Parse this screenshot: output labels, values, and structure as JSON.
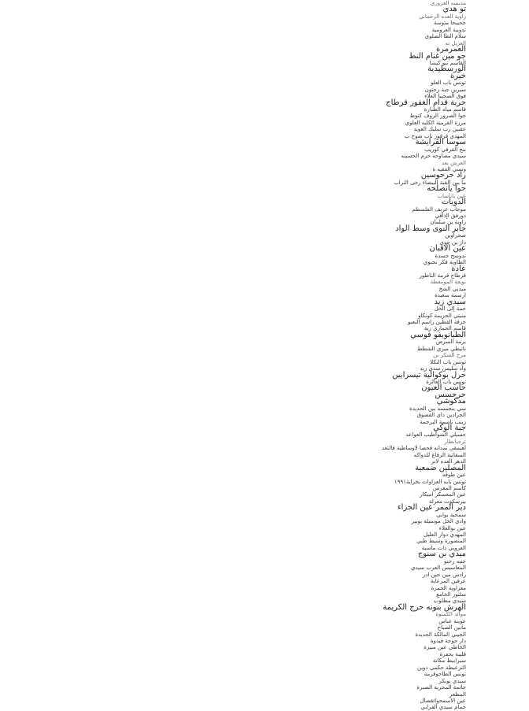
{
  "lines": [
    "مديسه الغزوري",
    "تو ھدي",
    "زاوية العده الرحماني",
    "جحيبحا متوسة",
    "تدويبة العرومية",
    "سلام الظا الصلوي",
    "العزيل نه",
    "العمرمرة",
    "جو مين غنام النط",
    "القاسم تبو كيسا",
    "الورسطيدية",
    "خيرة",
    "تونس باب العلو",
    "سيرين جبة رحتون",
    "فوق الصحيبا العلاء",
    "حربة قدام الغفور قرطاج",
    "قاسم مياه الطبارة",
    "جوا الصرور الروف كنوط",
    "مرزة القرمية الكليه العلوي",
    "عقبين رب سليك العويد",
    "المهدي قرقوز ناب شوخ ب",
    "سوسا القرايشة",
    "بنج القرفي كوريب",
    "سيدي مصاوحه حرم الحسينه",
    "العرش بعد",
    "ونسي الفقيه ة",
    "راد حرحوسين",
    "ما بين القبة البيضاء رحى التراب",
    "حوا يانصلحه",
    "عين باناساب",
    "الدويات",
    "موجاب عريف الفلسطم",
    "دورفق اإذاقي",
    "راوية بن سلمان",
    "جابر النوى وسط الواد",
    "صحراوين",
    "دار بن جوي",
    "عين الاقبان",
    "تدوسح جسدة",
    "الطاوية فكر نجبوي",
    "عادة",
    "قرطاج قرمة الناظور",
    "نويعة المومعطة",
    "ميديي الشخ",
    "ارسمة سعيدة",
    "سيدي زيد",
    "حمة إلى الخل",
    "منيتي الحزيمة كونكاو",
    "حرقة القطين راسم النعبو",
    "قاسم الحماري زية",
    "الطبانوبفو فوسي",
    "برمة السرص",
    "ناتيطي ميري الشطط",
    "مرح الشكر بن",
    "تونس باب النكلا",
    "واد سليمن سدي زيد",
    "حرل بوكوالية تيسرايين",
    "تونس باب العالرة",
    "حاسب العيون",
    "حرحسس",
    "مدكوشي",
    "سي بنجمسه بين الحديدة",
    "الجرادين داي القصوق",
    "زينب ناسمة البرجمة",
    "جبة الوكي",
    "حسيلي الشواطيب العواعد",
    "ترجبانطار",
    "اهيمقى تمدانه فحصا لاوساطية فالتعد",
    "السقاتية الرفاع للدواكه",
    "الدهر العده لابر",
    "المصلين ضمعبة",
    "عين طوقه",
    "تونس بابه الغزاوات بخرابة١٩٩١",
    "كاسم المعرس",
    "عين المعسكر اميكار",
    "بيرسكوت معرلة",
    "دير الممر عين الجزاء",
    "سمحية بوابي",
    "وادي الخل موسيلة بوبير",
    "عين بوالعلاء",
    "المهدي دوار العليل",
    "المنصورة وسيط طبي",
    "العروبي ذات ماسية",
    "ميدي بن سنوج",
    "جنبه رحنو",
    "المعاسيس العرب سيدي",
    "رادس مين حين ادر",
    "عرفين المرعاية",
    "معراوية الحمزة",
    "سلتوز الخامع",
    "سيدي مطلوب",
    "الهرش بنونه حرج الكريمة",
    "موائد الكمتوة",
    "عوينة عباس",
    "مابين الصباح",
    "الجيبي المالكة الجديدة",
    "دار جوحة فيدوة",
    "الخاطي عين مبيزة",
    "قليبة يحفرة",
    "سيرابيط مكانة",
    "التزعيطة حكمي دوين",
    "تونس الطاحوقرمة",
    "سيدي بوبكر",
    "جاثمة المحرية الصبرة",
    "المطعر",
    "عين الاسمحوائقصال",
    "حمام سيدي الفرابي"
  ]
}
